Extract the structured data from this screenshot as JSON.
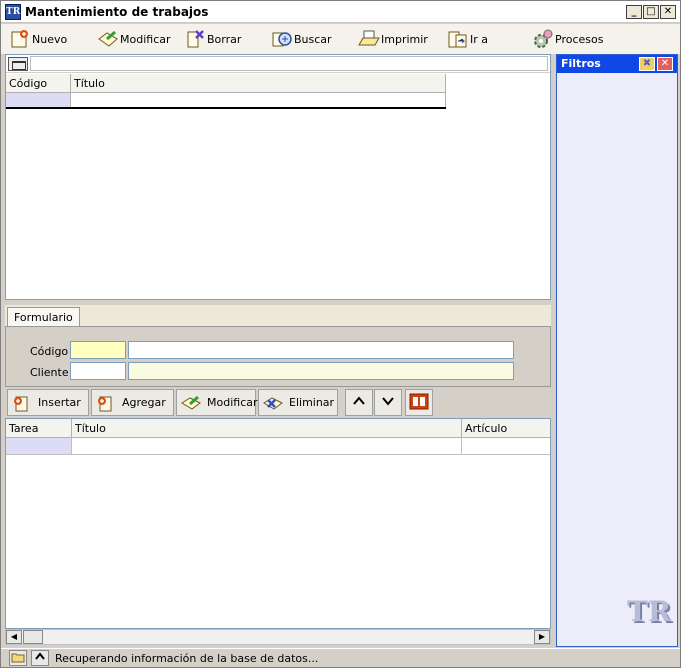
{
  "window": {
    "title": "Mantenimiento de trabajos",
    "app_icon_text": "TR",
    "minimize": "_",
    "maximize": "□",
    "close": "✕"
  },
  "toolbar": {
    "nuevo": "Nuevo",
    "modificar": "Modificar",
    "borrar": "Borrar",
    "buscar": "Buscar",
    "imprimir": "Imprimir",
    "ir_a": "Ir a",
    "procesos": "Procesos"
  },
  "top_grid": {
    "columns": [
      "Código",
      "Título"
    ]
  },
  "form": {
    "tab_label": "Formulario",
    "codigo_label": "Código",
    "cliente_label": "Cliente"
  },
  "subtoolbar": {
    "insertar": "Insertar",
    "agregar": "Agregar",
    "modificar": "Modificar",
    "eliminar": "Eliminar"
  },
  "bottom_grid": {
    "columns": [
      "Tarea",
      "Título",
      "Artículo"
    ]
  },
  "filters": {
    "title": "Filtros",
    "pin": "✖",
    "close": "✕",
    "logo_text": "TR"
  },
  "status": {
    "message": "Recuperando información de la base de datos..."
  },
  "colors": {
    "filters_header": "#1048e8",
    "filters_bg": "#ececfb",
    "codigo_field": "#ffffc0",
    "cliente_desc_field": "#fafae0",
    "selected_cell": "#dcdcf5"
  },
  "icons": {
    "toolbar": [
      "new-icon",
      "edit-icon",
      "delete-icon",
      "search-icon",
      "print-icon",
      "goto-icon",
      "processes-icon"
    ],
    "subtoolbar": [
      "insert-icon",
      "add-icon",
      "modify-icon",
      "delete-icon",
      "up-arrow-icon",
      "down-arrow-icon",
      "office-icon"
    ]
  }
}
